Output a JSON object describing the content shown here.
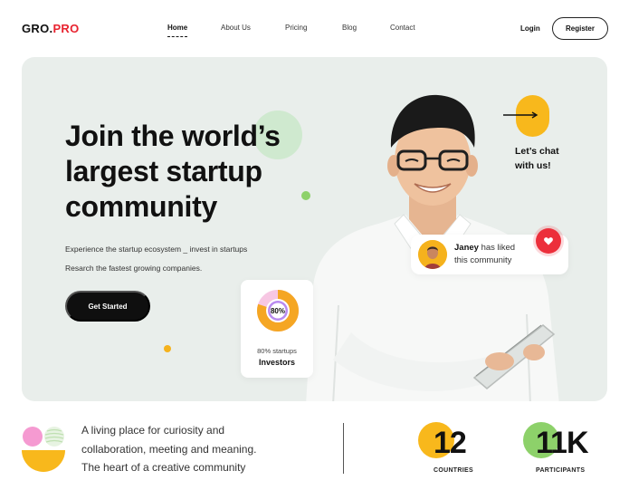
{
  "brand": {
    "logo_main": "GRO.",
    "logo_accent": "PRO",
    "accent_color": "#e8232f"
  },
  "nav": {
    "links": [
      {
        "label": "Home",
        "active": true
      },
      {
        "label": "About Us",
        "active": false
      },
      {
        "label": "Pricing",
        "active": false
      },
      {
        "label": "Blog",
        "active": false
      },
      {
        "label": "Contact",
        "active": false
      }
    ],
    "login_label": "Login",
    "register_label": "Register"
  },
  "hero": {
    "title": "Join the world’s largest startup community",
    "subtitle_line1": "Experience the startup ecosystem _ invest in startups",
    "subtitle_line2": "Resarch the fastest growing companies.",
    "cta_label": "Get Started",
    "investors": {
      "percent_label": "80%",
      "percent_value": 0.8,
      "caption": "80% startups",
      "label": "Investors"
    },
    "like_card": {
      "name": "Janey",
      "text_after_name": "has liked",
      "text_line2": "this community",
      "icon": "heart-icon"
    },
    "chat": {
      "line1": "Let’s chat",
      "line2": "with us!",
      "icon": "arrow-right-icon"
    }
  },
  "bottom": {
    "text_line1": "A living place for curiosity and",
    "text_line2": "collaboration, meeting and meaning.",
    "text_line3": "The heart of a creative community",
    "stats": [
      {
        "number": "12",
        "label": "COUNTRIES",
        "color": "#f8b81c"
      },
      {
        "number": "11K",
        "label": "PARTICIPANTS",
        "color": "#8dd16a"
      }
    ]
  },
  "colors": {
    "hero_bg": "#e9eeeb",
    "yellow": "#f8b81c",
    "green": "#8dd16a",
    "pink": "#f59ad1",
    "red": "#ec2f3b"
  }
}
